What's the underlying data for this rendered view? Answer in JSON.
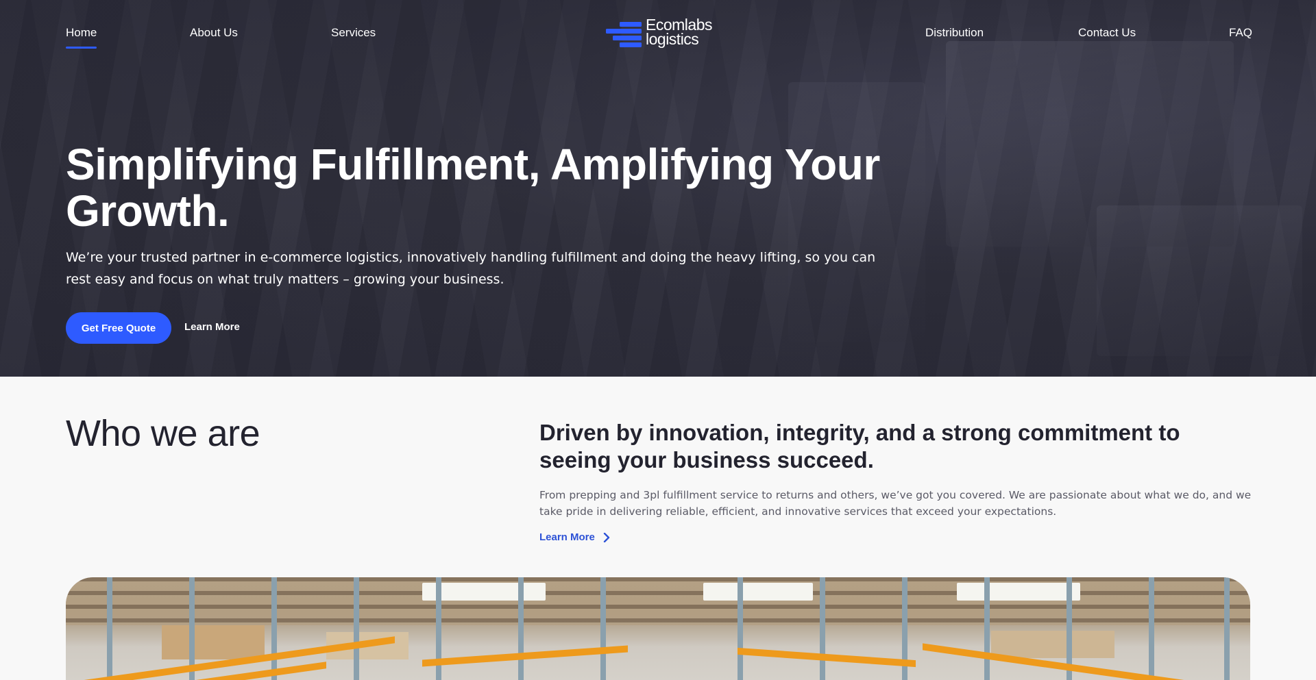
{
  "nav": {
    "left": [
      {
        "label": "Home",
        "active": true
      },
      {
        "label": "About Us"
      },
      {
        "label": "Services"
      }
    ],
    "right": [
      {
        "label": "Distribution"
      },
      {
        "label": "Contact Us"
      },
      {
        "label": "FAQ"
      }
    ],
    "logo": {
      "line1": "Ecomlabs",
      "line2": "logistics"
    }
  },
  "hero": {
    "title": "Simplifying Fulfillment, Amplifying Your Growth.",
    "subtitle": "We’re your trusted partner in e-commerce logistics, innovatively handling fulfillment and doing the heavy lifting, so you can rest easy and focus on what truly matters – growing your business.",
    "primary_button": "Get Free Quote",
    "secondary_button": "Learn More"
  },
  "who": {
    "title": "Who we are",
    "heading": "Driven by innovation, integrity, and a strong commitment to seeing your business succeed.",
    "text": "From prepping and 3pl fulfillment service to returns and others, we’ve got you covered. We are passionate about what we do, and we take pride in delivering reliable, efficient, and innovative services that exceed your expectations.",
    "link": "Learn More"
  },
  "colors": {
    "accent": "#2e5bff",
    "link": "#2d52d6",
    "dark_text": "#23232f",
    "rack_orange": "#ee9a1c"
  }
}
